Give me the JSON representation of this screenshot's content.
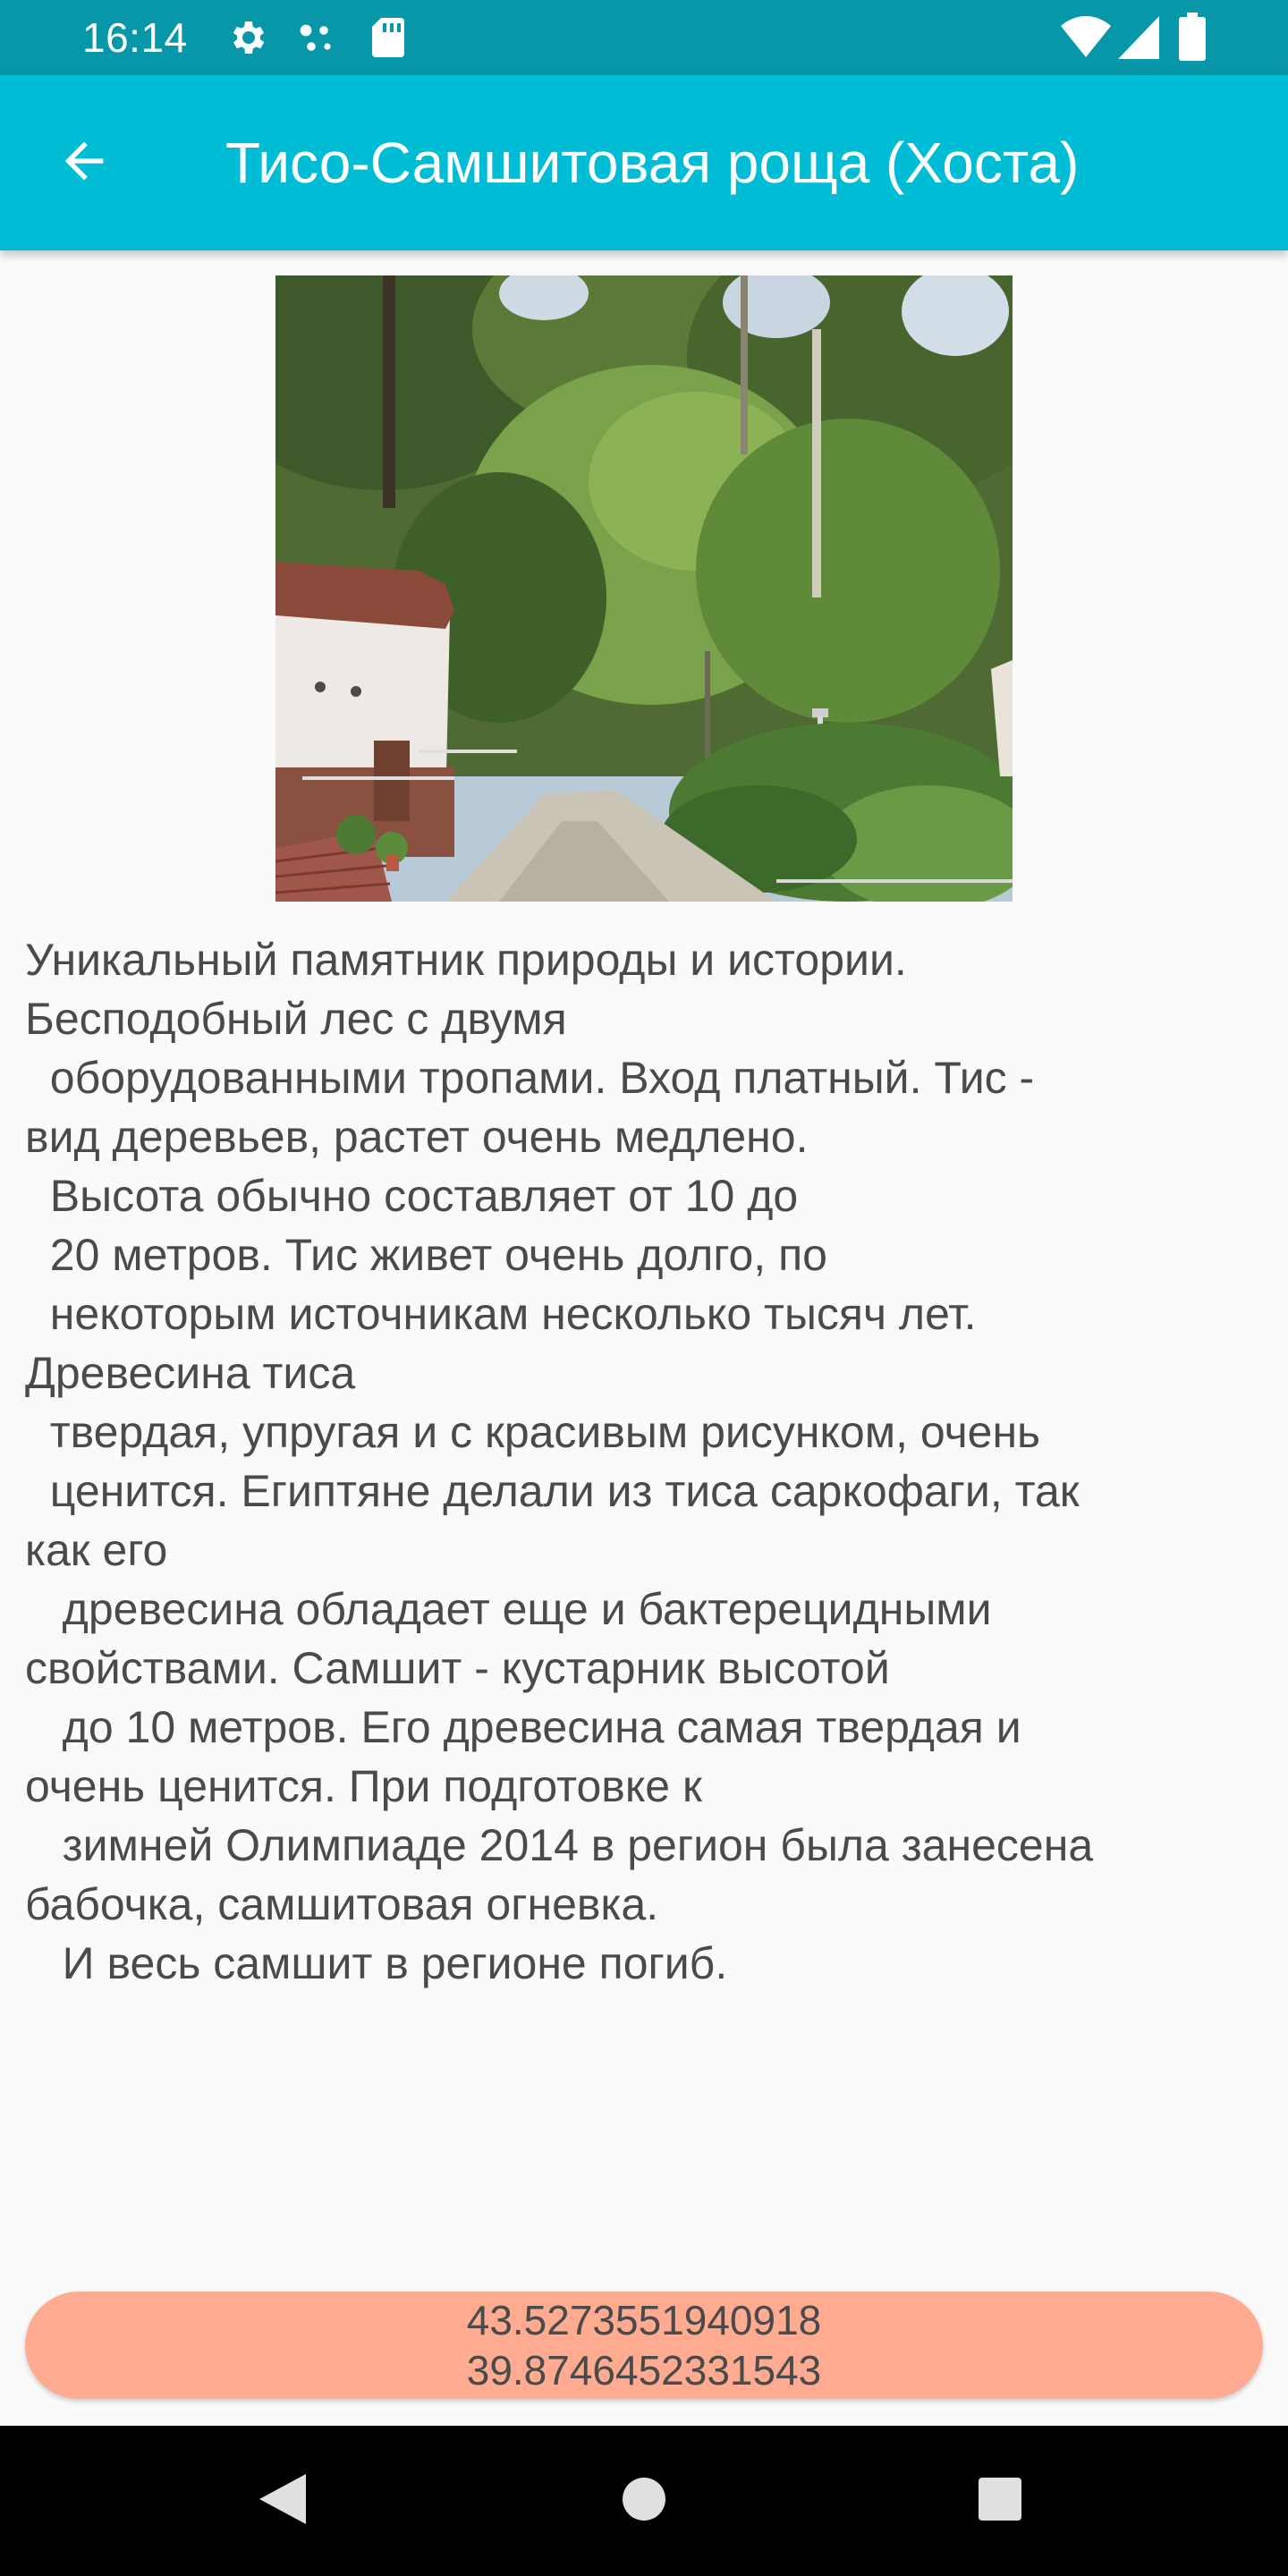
{
  "status_bar": {
    "time": "16:14",
    "icons": [
      "gear-icon",
      "dots-icon",
      "sd-card-icon",
      "wifi-icon",
      "signal-icon",
      "battery-icon"
    ],
    "background": "#0897a8"
  },
  "app_bar": {
    "title": "Тисо-Самшитовая роща (Хоста)",
    "back_icon": "arrow-back-icon",
    "background": "#00bcd4"
  },
  "photo": {
    "icon": "park-photo"
  },
  "description": "Уникальный памятник природы и истории.\nБесподобный лес с двумя\n  оборудованными тропами. Вход платный. Тис -\nвид деревьев, растет очень медлено.\n  Высота обычно составляет от 10 до\n  20 метров. Тис живет очень долго, по\n  некоторым источникам несколько тысяч лет.\nДревесина тиса\n  твердая, упругая и с красивым рисунком, очень\n  ценится. Египтяне делали из тиса саркофаги, так\nкак его\n   древесина обладает еще и бактерецидными\nсвойствами. Самшит - кустарник высотой\n   до 10 метров. Его древесина самая твердая и\nочень ценится. При подготовке к\n   зимней Олимпиаде 2014 в регион была занесена\nбабочка, самшитовая огневка.\n   И весь самшит в регионе погиб.",
  "coordinates": {
    "latitude": "43.5273551940918",
    "longitude": "39.8746452331543",
    "background": "#ffab91"
  },
  "nav_bar": {
    "back_icon": "nav-back-icon",
    "home_icon": "nav-home-icon",
    "recents_icon": "nav-recents-icon"
  }
}
